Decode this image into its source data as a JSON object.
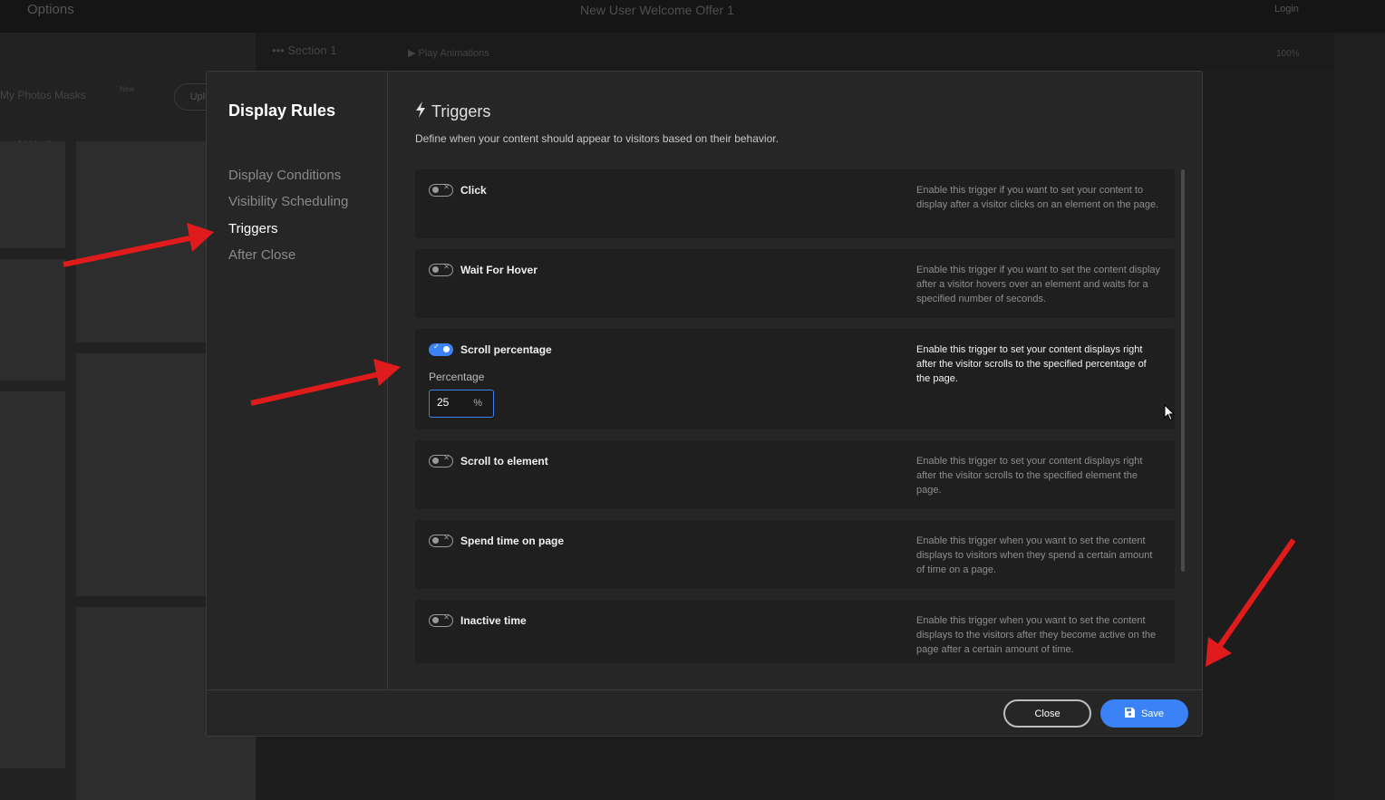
{
  "background": {
    "app_title": "Options",
    "document_title": "New User Welcome Offer 1",
    "login_label": "Login",
    "tabs_text": "My Photos    Masks",
    "new_badge": "New",
    "upload_label": "Upload",
    "gallery_heading": "and Work",
    "section_label": "Section 1",
    "play_animations_label": "Play Animations",
    "zoom_label": "100%"
  },
  "modal": {
    "title": "Display Rules",
    "nav": [
      {
        "label": "Display Conditions",
        "active": false
      },
      {
        "label": "Visibility Scheduling",
        "active": false
      },
      {
        "label": "Triggers",
        "active": true
      },
      {
        "label": "After Close",
        "active": false
      }
    ],
    "section_title": "Triggers",
    "section_icon": "lightning-bolt-icon",
    "section_description": "Define when your content should appear to visitors based on their behavior.",
    "triggers": [
      {
        "label": "Click",
        "enabled": false,
        "description": "Enable this trigger if you want to set your content to display after a visitor clicks on an element on the page."
      },
      {
        "label": "Wait For Hover",
        "enabled": false,
        "description": "Enable this trigger if you want to set the content display after a visitor hovers over an element and waits for a specified number of seconds."
      },
      {
        "label": "Scroll percentage",
        "enabled": true,
        "description": "Enable this trigger to set your content displays right after the visitor scrolls to the specified percentage of the page."
      },
      {
        "label": "Scroll to element",
        "enabled": false,
        "description": "Enable this trigger to set your content displays right after the visitor scrolls to the specified element the page."
      },
      {
        "label": "Spend time on page",
        "enabled": false,
        "description": "Enable this trigger when you want to set the content displays to visitors when they spend a certain amount of time on a page."
      },
      {
        "label": "Inactive time",
        "enabled": false,
        "description": "Enable this trigger when you want to set the content displays to the visitors after they become active on the page after a certain amount of time."
      }
    ],
    "percentage": {
      "label": "Percentage",
      "value": "25",
      "unit": "%"
    },
    "close_label": "Close",
    "save_label": "Save",
    "accent_color": "#3b82f6",
    "annotation_color": "#e01b1b"
  }
}
